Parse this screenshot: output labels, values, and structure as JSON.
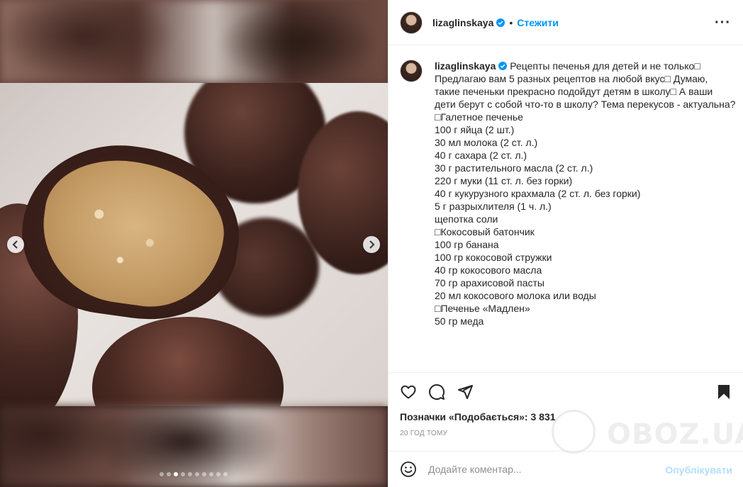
{
  "post": {
    "username": "lizaglinskaya",
    "separator": "•",
    "follow_label": "Стежити",
    "more_icon": "more-horizontal-icon",
    "caption_lines": [
      "Рецепты печенья для детей и не только\u0000",
      "Предлагаю вам 5 разных рецептов на любой вкус\u0000 Думаю,",
      "такие печеньки прекрасно подойдут детям в школу\u0000 А ваши",
      "дети берут с собой что-то в школу? Тема перекусов - актуальна?",
      "",
      "\u0000Галетное печенье",
      "100 г яйца (2 шт.)",
      "30 мл молока (2 ст. л.)",
      "40 г сахара (2 ст. л.)",
      "30 г растительного масла (2 ст. л.)",
      "220 г муки (11 ст. л. без горки)",
      "40 г кукурузного крахмала (2 ст. л. без горки)",
      "5 г разрыхлителя (1 ч. л.)",
      "щепотка соли",
      "",
      "\u0000Кокосовый батончик",
      "100 гр банана",
      "100 гр кокосовой стружки",
      "40 гр кокосового масла",
      "70 гр арахисовой пасты",
      "20 мл кокосового молока или воды",
      "",
      "\u0000Печенье «Мадлен»",
      "50 гр меда"
    ],
    "likes_text": "Позначки «Подобається»: 3 831",
    "time_text": "20 ГОД ТОМУ",
    "comment_placeholder": "Додайте коментар...",
    "publish_label": "Опублікувати"
  },
  "carousel": {
    "total_slides": 10,
    "active_index": 2
  },
  "watermark": {
    "text": "OBOZ.UA"
  },
  "colors": {
    "accent": "#0095f6",
    "publish_disabled": "#b2dffc",
    "muted": "#8e8e8e"
  }
}
